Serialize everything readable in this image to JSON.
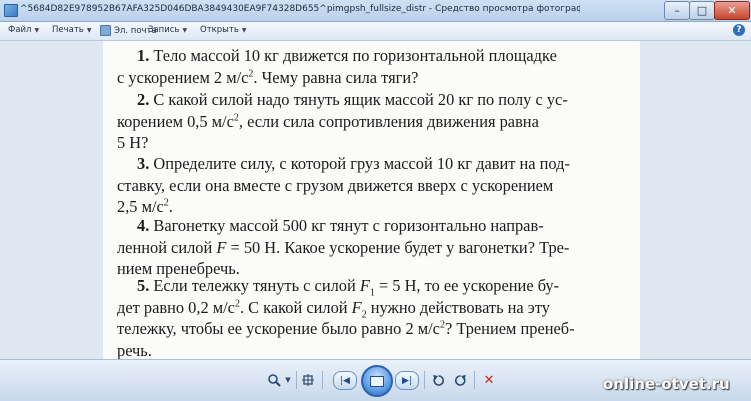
{
  "window": {
    "title": "^5684D82E978952B67AFA325D046DBA3849430EA9F74328D655^pimgpsh_fullsize_distr - Средство просмотра фотографий Windows",
    "minimize_label": "–",
    "maximize_label": "□",
    "close_label": "✕"
  },
  "menu": {
    "file": "Файл",
    "print": "Печать",
    "email": "Эл. почта",
    "burn": "Запись",
    "open": "Открыть",
    "help": "?"
  },
  "problems": [
    {
      "num": "1.",
      "line1": "Тело массой 10 кг движется по горизонтальной площадке",
      "line2_pre": "с ускорением 2 м/с",
      "line2_sup": "2",
      "line2_post": ". Чему равна сила тяги?"
    },
    {
      "num": "2.",
      "line1": "С какой силой надо тянуть ящик массой 20 кг по полу с ус-",
      "line2_pre": "корением 0,5 м/с",
      "line2_sup": "2",
      "line2_post": ", если сила сопротивления движения равна",
      "line3": "5 Н?"
    },
    {
      "num": "3.",
      "line1": "Определите силу, с которой груз массой 10 кг давит на под-",
      "line2": "ставку, если она вместе с грузом движется вверх с ускорением",
      "line3_pre": "2,5 м/с",
      "line3_sup": "2",
      "line3_post": "."
    },
    {
      "num": "4.",
      "line1": "Вагонетку массой 500 кг тянут с горизонтально направ-",
      "line2_pre": "ленной силой ",
      "line2_var": "F",
      "line2_post": " = 50 Н. Какое ускорение будет у вагонетки? Тре-",
      "line3": "нием пренебречь."
    },
    {
      "num": "5.",
      "line1_pre": "Если тележку тянуть с силой ",
      "line1_var": "F",
      "line1_sub": "1",
      "line1_post": " = 5 Н, то ее ускорение бу-",
      "line2_pre": "дет равно 0,2 м/с",
      "line2_sup": "2",
      "line2_mid": ". С какой силой ",
      "line2_var": "F",
      "line2_sub": "2",
      "line2_post": " нужно действовать на эту",
      "line3_pre": "тележку, чтобы ее ускорение было равно 2 м/с",
      "line3_sup": "2",
      "line3_post": "? Трением пренеб-",
      "line4": "речь."
    }
  ],
  "toolbar": {
    "zoom_icon": "magnifier-icon",
    "actual_size_icon": "fit-icon",
    "prev_icon": "previous-icon",
    "slideshow_icon": "slideshow-icon",
    "next_icon": "next-icon",
    "rotate_ccw_icon": "rotate-left-icon",
    "rotate_cw_icon": "rotate-right-icon",
    "delete_icon": "delete-icon"
  },
  "watermark": "online-otvet.ru"
}
